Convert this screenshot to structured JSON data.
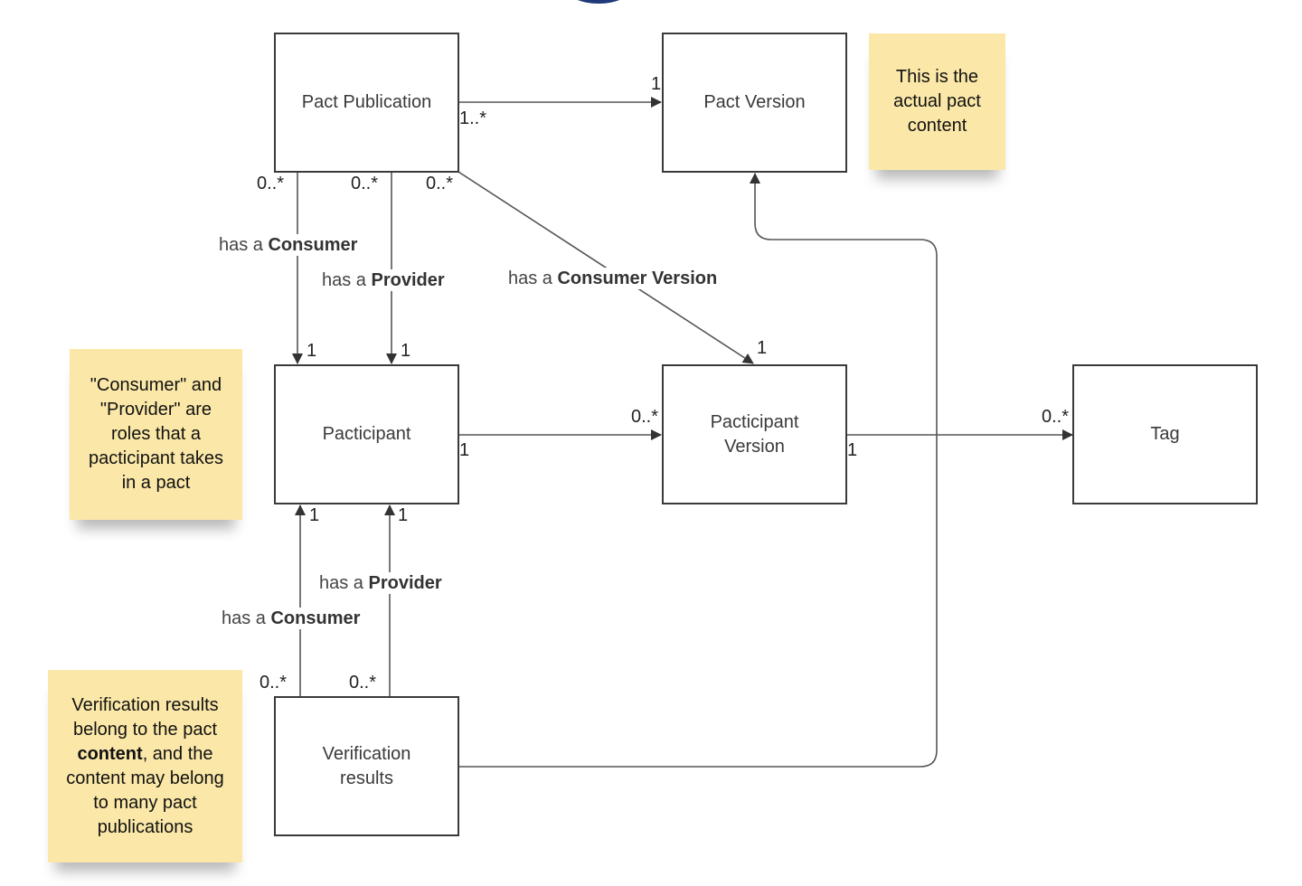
{
  "diagram": {
    "entities": {
      "pact_publication": "Pact Publication",
      "pact_version": "Pact Version",
      "participant": "Pacticipant",
      "participant_version_line1": "Pacticipant",
      "participant_version_line2": "Version",
      "tag": "Tag",
      "verification_results_line1": "Verification",
      "verification_results_line2": "results"
    },
    "notes": {
      "pact_content": [
        "This is the",
        "actual pact",
        "content"
      ],
      "roles": [
        "\"Consumer\" and",
        "\"Provider\" are",
        "roles that a",
        "pacticipant takes",
        "in a pact"
      ],
      "verification": {
        "line1": "Verification results",
        "line2": "belong to the pact",
        "line3_bold": "content",
        "line3_rest": ", and the",
        "line4": "content may belong",
        "line5": "to many pact",
        "line6": "publications"
      }
    },
    "edge_labels": {
      "pub_consumer": {
        "prefix": "has a ",
        "bold": "Consumer"
      },
      "pub_provider": {
        "prefix": "has a ",
        "bold": "Provider"
      },
      "pub_consumer_version": {
        "prefix": "has a ",
        "bold": "Consumer Version"
      },
      "ver_provider": {
        "prefix": "has a ",
        "bold": "Provider"
      },
      "ver_consumer": {
        "prefix": "has a ",
        "bold": "Consumer"
      }
    },
    "multiplicities": {
      "pub_to_version_src": "1..*",
      "pub_to_version_dst": "1",
      "pub_consumer_src": "0..*",
      "pub_provider_src": "0..*",
      "pub_cv_src": "0..*",
      "pub_consumer_dst": "1",
      "pub_provider_dst": "1",
      "pub_cv_dst": "1",
      "part_to_pv_src": "1",
      "part_to_pv_dst": "0..*",
      "pv_to_tag_src": "1",
      "pv_to_tag_dst": "0..*",
      "ver_consumer_dst": "1",
      "ver_provider_dst": "1",
      "ver_consumer_src": "0..*",
      "ver_provider_src": "0..*"
    },
    "colors": {
      "note_fill": "#fbe8a8",
      "box_stroke": "#3a3a3a",
      "edge_stroke": "#555555"
    }
  }
}
